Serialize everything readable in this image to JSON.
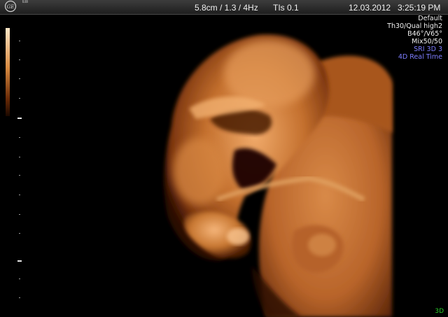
{
  "header": {
    "logo_icon": "ge-logo-icon",
    "logo_label": "EB",
    "scan_params": "5.8cm / 1.3 / 4Hz",
    "tis": "TIs  0.1",
    "date": "12.03.2012",
    "time": "3:25:19 PM"
  },
  "settings": [
    {
      "text": "Default",
      "color": "#f2f2f2"
    },
    {
      "text": "Th30/Qual high2",
      "color": "#f2f2f2"
    },
    {
      "text": "B46°/V65°",
      "color": "#f2f2f2"
    },
    {
      "text": "Mix50/50",
      "color": "#f2f2f2"
    },
    {
      "text": "SRI 3D 3",
      "color": "#7e7eff"
    },
    {
      "text": "4D Real Time",
      "color": "#7e7eff"
    }
  ],
  "mode_badge": "3D",
  "colors": {
    "background": "#000000",
    "tissue_light": "#e59a5e",
    "tissue_mid": "#b8642a",
    "tissue_dark": "#5a2408",
    "settings_accent": "#7e7eff",
    "badge": "#2bd02b"
  }
}
